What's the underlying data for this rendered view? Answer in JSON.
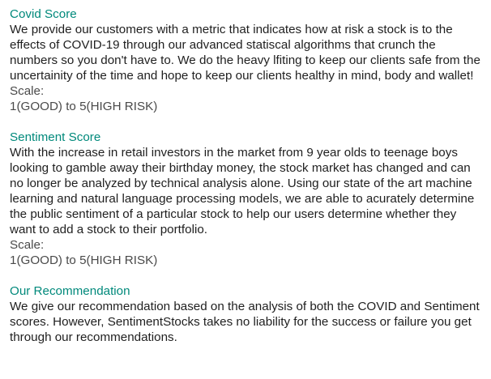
{
  "colors": {
    "heading": "#00897b",
    "body_text": "#1f1f1f",
    "scale_text": "#4a4a4a"
  },
  "covid": {
    "title": "Covid Score",
    "description": "We provide our customers with a metric that indicates how at risk a stock is to the effects of COVID-19 through our advanced statiscal algorithms that crunch the numbers so you don't have to. We do the heavy lfiting to keep our clients safe from the uncertainity of the time and hope to keep our clients healthy in mind, body and wallet!",
    "scale_label": "Scale:",
    "scale_value": "1(GOOD) to 5(HIGH RISK)"
  },
  "sentiment": {
    "title": "Sentiment Score",
    "description": "With the increase in retail investors in the market from 9 year olds to teenage boys looking to gamble away their birthday money, the stock market has changed and can no longer be analyzed by technical analysis alone. Using our state of the art machine learning and natural language processing models, we are able to acurately determine the public sentiment of a particular stock to help our users determine whether they want to add a stock to their portfolio.",
    "scale_label": "Scale:",
    "scale_value": "1(GOOD) to 5(HIGH RISK)"
  },
  "recommendation": {
    "title": "Our Recommendation",
    "description": "We give our recommendation based on the analysis of both the COVID and Sentiment scores. However, SentimentStocks takes no liability for the success or failure you get through our recommendations."
  }
}
